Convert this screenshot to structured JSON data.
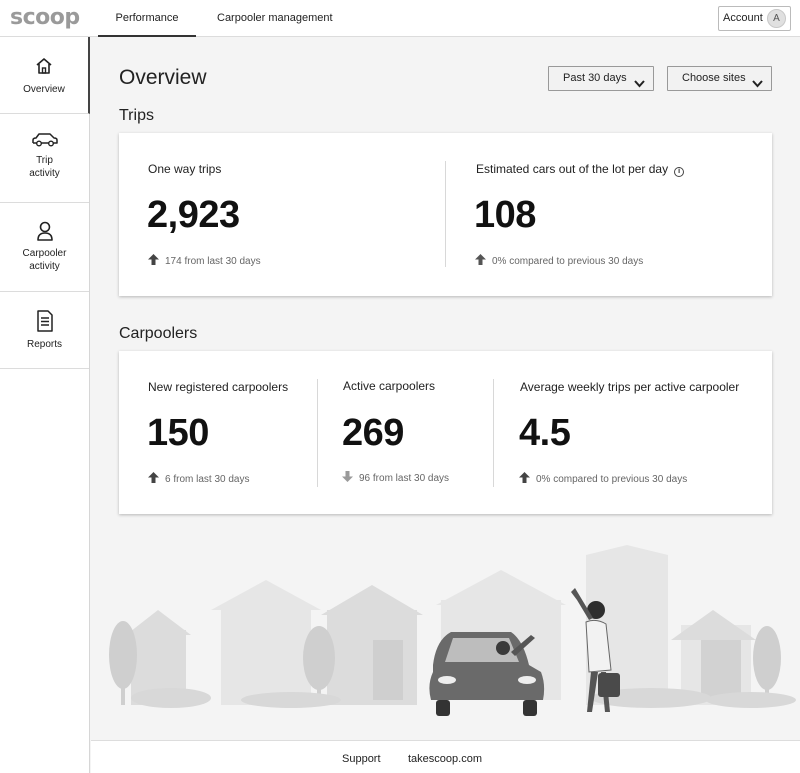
{
  "app": {
    "logo": "scoop"
  },
  "topnav": {
    "tabs": [
      {
        "label": "Performance",
        "active": true
      },
      {
        "label": "Carpooler management",
        "active": false
      }
    ],
    "account": {
      "label": "Account",
      "avatar_initial": "A"
    }
  },
  "sidebar": {
    "items": [
      {
        "label": "Overview",
        "icon": "home-icon",
        "active": true
      },
      {
        "label": "Trip activity",
        "icon": "car-icon",
        "active": false
      },
      {
        "label": "Carpooler activity",
        "icon": "person-icon",
        "active": false
      },
      {
        "label": "Reports",
        "icon": "document-icon",
        "active": false
      }
    ]
  },
  "header": {
    "title": "Overview",
    "date_filter": "Past 30 days",
    "site_filter": "Choose sites"
  },
  "trips": {
    "section_title": "Trips",
    "metrics": [
      {
        "label": "One way trips",
        "value": "2,923",
        "change": "174 from last 30 days",
        "direction": "up"
      },
      {
        "label": "Estimated cars out of the lot per day",
        "value": "108",
        "change": "0% compared to previous 30 days",
        "direction": "up",
        "has_info": true
      }
    ]
  },
  "carpoolers": {
    "section_title": "Carpoolers",
    "metrics": [
      {
        "label": "New registered carpoolers",
        "value": "150",
        "change": "6 from last 30 days",
        "direction": "up"
      },
      {
        "label": "Active carpoolers",
        "value": "269",
        "change": "96 from last 30 days",
        "direction": "down"
      },
      {
        "label": "Average weekly trips per active carpooler",
        "value": "4.5",
        "change": "0% compared to previous 30 days",
        "direction": "up"
      }
    ]
  },
  "footer": {
    "links": [
      "Support",
      "takescoop.com"
    ]
  },
  "colors": {
    "accent": "#333333",
    "card_bg": "#ffffff",
    "page_bg": "#f4f4f4",
    "up_arrow": "#444444",
    "down_arrow": "#999999"
  }
}
